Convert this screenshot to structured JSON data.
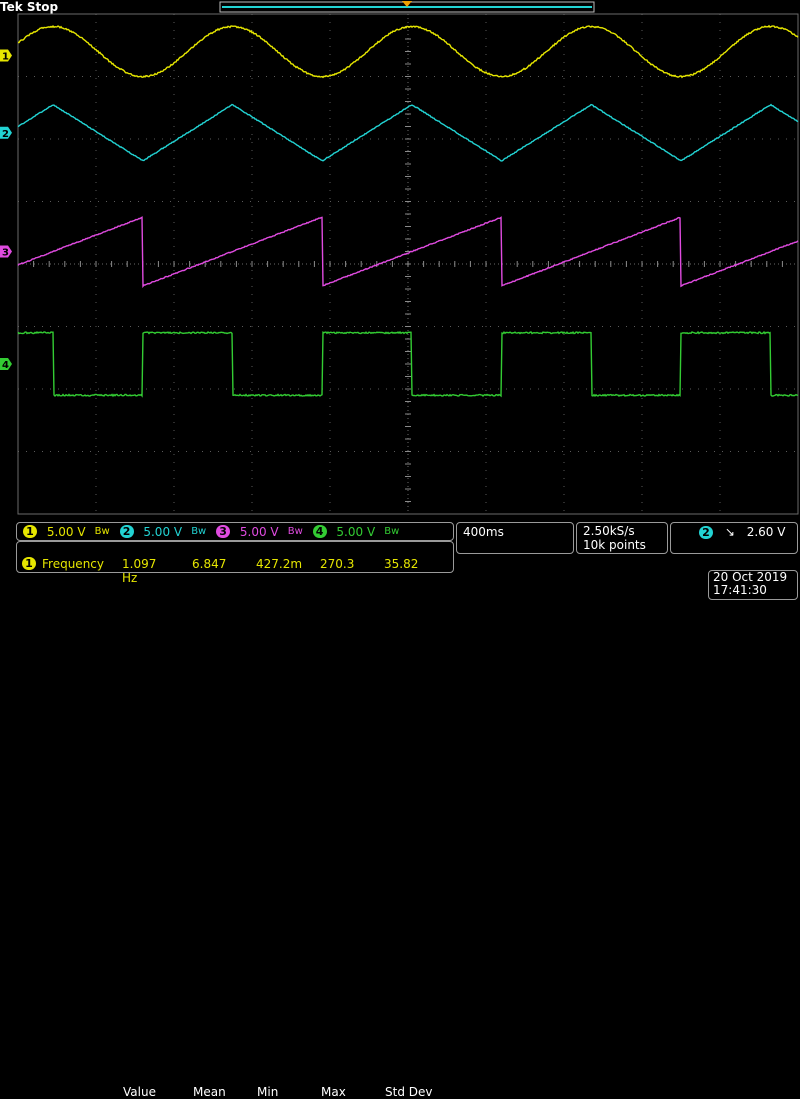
{
  "header": {
    "brand": "Tek",
    "state": "Stop"
  },
  "channels": [
    {
      "num": "1",
      "color": "#e6e600",
      "scale": "5.00 V"
    },
    {
      "num": "2",
      "color": "#22d3d3",
      "scale": "5.00 V"
    },
    {
      "num": "3",
      "color": "#e04be0",
      "scale": "5.00 V"
    },
    {
      "num": "4",
      "color": "#33cc33",
      "scale": "5.00 V"
    }
  ],
  "bandwidth_glyph": "Bw",
  "timebase": "400ms",
  "acquisition": {
    "sample_rate": "2.50kS/s",
    "record_length": "10k points"
  },
  "trigger": {
    "channel": "2",
    "slope_glyph": "↘",
    "level": "2.60 V"
  },
  "measurement": {
    "channel": "1",
    "name": "Frequency",
    "headers": [
      "Value",
      "Mean",
      "Min",
      "Max",
      "Std Dev"
    ],
    "values": [
      "1.097 Hz",
      "6.847",
      "427.2m",
      "270.3",
      "35.82"
    ]
  },
  "datetime": {
    "date": "20 Oct  2019",
    "time": "17:41:30"
  },
  "chart_data": {
    "type": "line",
    "x_divisions": 10,
    "y_divisions": 8,
    "grid": true,
    "period_divisions": 2.3,
    "series": [
      {
        "name": "1",
        "shape": "sine",
        "color": "#e6e600",
        "center_div": 3.4,
        "amplitude_div": 0.4
      },
      {
        "name": "2",
        "shape": "triangle",
        "color": "#22d3d3",
        "center_div": 2.1,
        "amplitude_div": 0.45
      },
      {
        "name": "3",
        "shape": "sawtooth",
        "color": "#e04be0",
        "center_div": 0.2,
        "amplitude_div": 0.55
      },
      {
        "name": "4",
        "shape": "square",
        "color": "#33cc33",
        "center_div": -1.6,
        "amplitude_div": 0.5
      }
    ]
  }
}
